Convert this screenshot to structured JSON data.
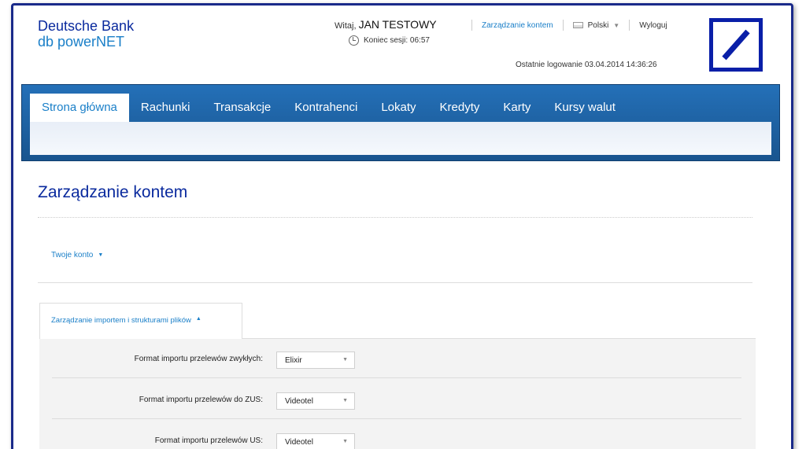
{
  "brand": {
    "line1": "Deutsche Bank",
    "line2": "db powerNET"
  },
  "header": {
    "welcome_prefix": "Witaj,",
    "user_name": "JAN TESTOWY",
    "session_label": "Koniec sesji: 06:57",
    "manage_link": "Zarządzanie kontem",
    "language": "Polski",
    "logout": "Wyloguj",
    "last_login": "Ostatnie logowanie 03.04.2014 14:36:26"
  },
  "nav": {
    "tabs": [
      {
        "label": "Strona główna",
        "active": true
      },
      {
        "label": "Rachunki"
      },
      {
        "label": "Transakcje"
      },
      {
        "label": "Kontrahenci"
      },
      {
        "label": "Lokaty"
      },
      {
        "label": "Kredyty"
      },
      {
        "label": "Karty"
      },
      {
        "label": "Kursy walut"
      }
    ]
  },
  "page": {
    "title": "Zarządzanie kontem",
    "account_toggle": "Twoje konto",
    "section_tab": "Zarządzanie importem i strukturami plików"
  },
  "form": {
    "rows": [
      {
        "label": "Format importu przelewów zwykłych:",
        "value": "Elixir"
      },
      {
        "label": "Format importu przelewów do ZUS:",
        "value": "Videotel"
      },
      {
        "label": "Format importu przelewów US:",
        "value": "Videotel"
      }
    ]
  },
  "colors": {
    "brand_blue": "#0a2a9e",
    "accent": "#1a7fc8",
    "nav_bg": "#1e63a8"
  }
}
